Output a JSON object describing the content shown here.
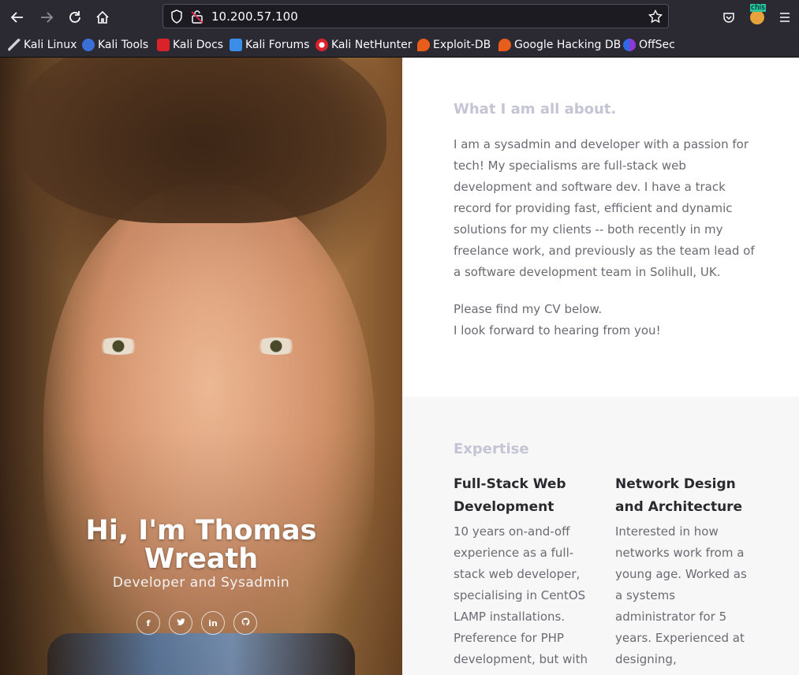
{
  "browser": {
    "url": "10.200.57.100",
    "extension_badge": "chis",
    "bookmarks": [
      {
        "label": "Kali Linux",
        "icon": "kali-dragon-icon"
      },
      {
        "label": "Kali Tools",
        "icon": "kali-tools-icon"
      },
      {
        "label": "Kali Docs",
        "icon": "kali-docs-icon"
      },
      {
        "label": "Kali Forums",
        "icon": "kali-forums-icon"
      },
      {
        "label": "Kali NetHunter",
        "icon": "kali-nethunter-icon"
      },
      {
        "label": "Exploit-DB",
        "icon": "exploit-db-icon"
      },
      {
        "label": "Google Hacking DB",
        "icon": "ghdb-icon"
      },
      {
        "label": "OffSec",
        "icon": "offsec-icon"
      }
    ]
  },
  "hero": {
    "title_line1": "Hi, I'm Thomas",
    "title_line2": "Wreath",
    "subtitle": "Developer and Sysadmin",
    "social": [
      "f",
      "t",
      "in",
      "gh"
    ]
  },
  "about": {
    "title": "What I am all about.",
    "paragraph1": "I am a sysadmin and developer with a passion for tech! My specialisms are full-stack web development and software dev. I have a track record for providing fast, efficient and dynamic solutions for my clients -- both recently in my freelance work, and previously as the team lead of a software development team in Solihull, UK.",
    "paragraph2_line1": "Please find my CV below.",
    "paragraph2_line2": "I look forward to hearing from you!"
  },
  "expertise": {
    "title": "Expertise",
    "items": [
      {
        "heading": "Full-Stack Web Development",
        "text": "10 years on-and-off experience as a full-stack web developer, specialising in CentOS LAMP installations. Preference for PHP development, but with"
      },
      {
        "heading": "Network Design and Architecture",
        "text": "Interested in how networks work from a young age. Worked as a systems administrator for 5 years. Experienced at designing,"
      }
    ]
  },
  "colors": {
    "chrome_bg": "#2b2a33",
    "section_title": "#c4c4d4",
    "body_text": "#6a6a72",
    "heading_text": "#2a2a2e"
  }
}
